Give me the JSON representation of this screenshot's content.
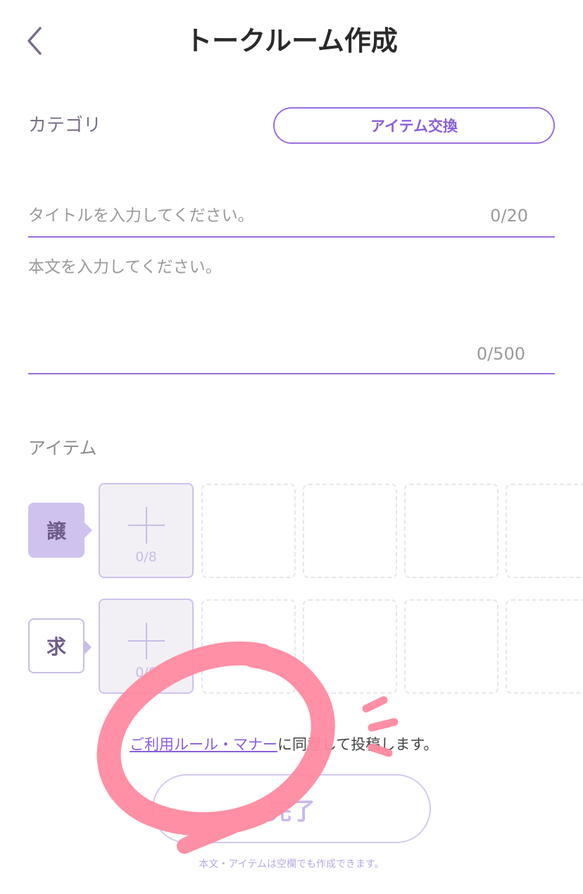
{
  "header": {
    "title": "トークルーム作成",
    "back_icon": "chevron-left-icon"
  },
  "category": {
    "label": "カテゴリ",
    "selected": "アイテム交換"
  },
  "title_field": {
    "placeholder": "タイトルを入力してください。",
    "value": "",
    "counter": "0/20"
  },
  "body_field": {
    "placeholder": "本文を入力してください。",
    "value": "",
    "counter": "0/500"
  },
  "items": {
    "label": "アイテム",
    "give": {
      "tag": "譲",
      "count": "0/8"
    },
    "want": {
      "tag": "求",
      "count": "0/8"
    }
  },
  "agreement": {
    "link_text": "ご利用ルール・マナー",
    "suffix_text": "に同意して投稿します。"
  },
  "submit": {
    "label": "完了",
    "hint": "本文・アイテムは空欄でも作成できます。"
  },
  "colors": {
    "accent": "#9b6ee0",
    "accent_light": "#cfc2ef",
    "annotation": "#ff8aa0"
  }
}
